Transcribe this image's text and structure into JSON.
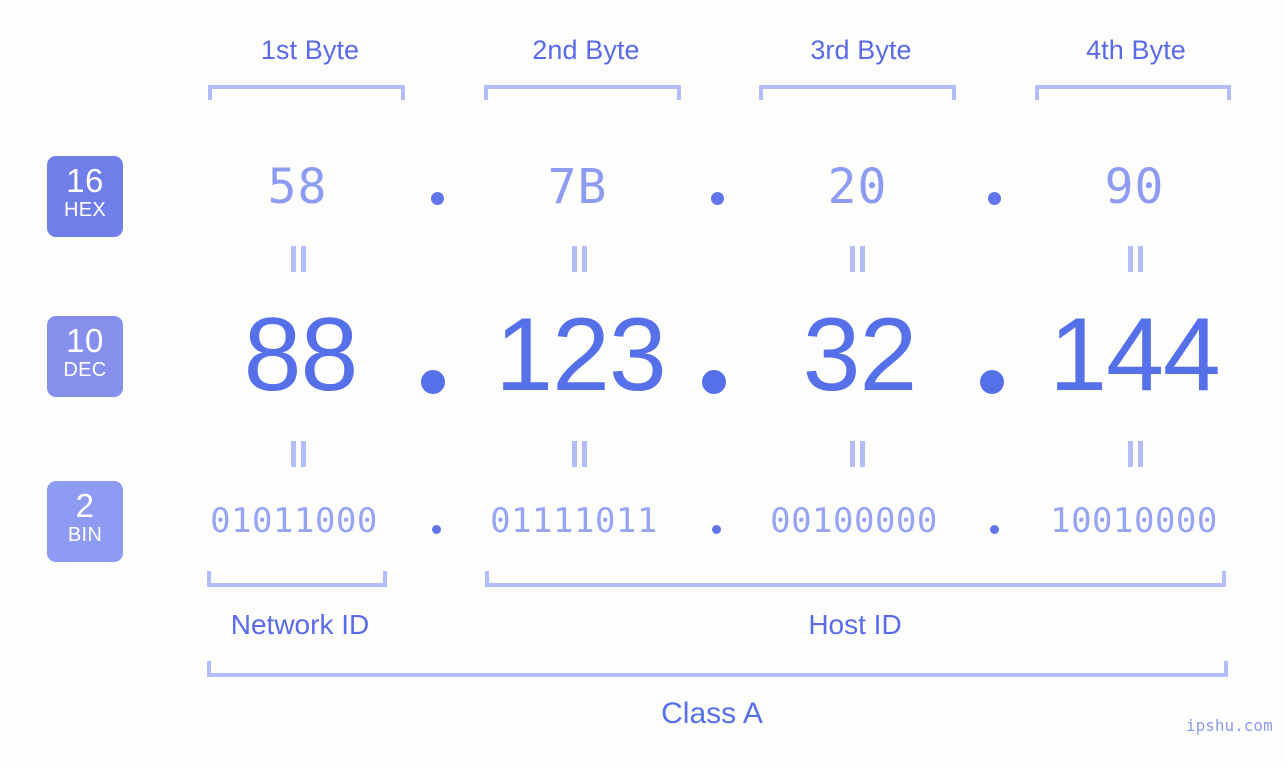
{
  "theme": {
    "background": "#fdfefb",
    "accent_strong": "#5570e8",
    "accent_mid": "#8e9bf2",
    "accent_light": "#b3bdf9",
    "badge_hex": "#707ee8",
    "badge_dec": "#8690ec",
    "badge_bin": "#8e9bf2"
  },
  "byte_headers": [
    {
      "label": "1st Byte"
    },
    {
      "label": "2nd Byte"
    },
    {
      "label": "3rd Byte"
    },
    {
      "label": "4th Byte"
    }
  ],
  "bases": {
    "hex": {
      "number": "16",
      "abbr": "HEX"
    },
    "dec": {
      "number": "10",
      "abbr": "DEC"
    },
    "bin": {
      "number": "2",
      "abbr": "BIN"
    }
  },
  "rows": {
    "hex": {
      "values": [
        "58",
        "7B",
        "20",
        "90"
      ],
      "separator": "."
    },
    "dec": {
      "values": [
        "88",
        "123",
        "32",
        "144"
      ],
      "separator": "."
    },
    "bin": {
      "values": [
        "01011000",
        "01111011",
        "00100000",
        "10010000"
      ],
      "separator": "."
    }
  },
  "ip_address": {
    "dec": "88.123.32.144",
    "hex": "58.7B.20.90",
    "bin": "01011000.01111011.00100000.10010000"
  },
  "sections": {
    "network_id": "Network ID",
    "host_id": "Host ID",
    "class": "Class A"
  },
  "watermark": "ipshu.com"
}
